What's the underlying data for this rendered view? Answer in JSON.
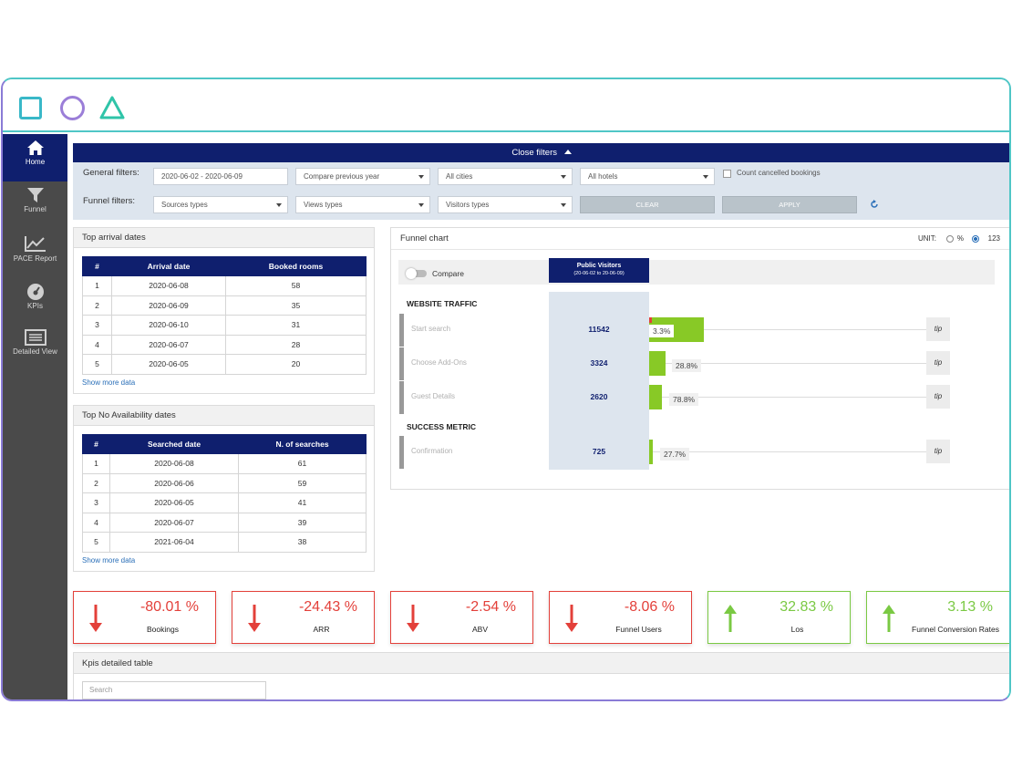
{
  "sidebar": {
    "items": [
      {
        "label": "Home",
        "icon": "home-icon"
      },
      {
        "label": "Funnel",
        "icon": "funnel-icon"
      },
      {
        "label": "PACE Report",
        "icon": "chart-line-icon"
      },
      {
        "label": "KPIs",
        "icon": "gauge-icon"
      },
      {
        "label": "Detailed View",
        "icon": "list-icon"
      }
    ]
  },
  "filters": {
    "toggle_label": "Close filters",
    "general_label": "General filters:",
    "funnel_label": "Funnel filters:",
    "date_range": "2020-06-02 - 2020-06-09",
    "compare": "Compare previous year",
    "cities": "All cities",
    "hotels": "All hotels",
    "count_cancelled": "Count cancelled bookings",
    "sources": "Sources types",
    "views": "Views types",
    "visitors": "Visitors types",
    "clear": "CLEAR",
    "apply": "APPLY"
  },
  "arrival": {
    "title": "Top arrival dates",
    "headers": [
      "#",
      "Arrival date",
      "Booked rooms"
    ],
    "rows": [
      [
        "1",
        "2020-06-08",
        "58"
      ],
      [
        "2",
        "2020-06-09",
        "35"
      ],
      [
        "3",
        "2020-06-10",
        "31"
      ],
      [
        "4",
        "2020-06-07",
        "28"
      ],
      [
        "5",
        "2020-06-05",
        "20"
      ]
    ],
    "more": "Show more data"
  },
  "noavail": {
    "title": "Top No Availability dates",
    "headers": [
      "#",
      "Searched date",
      "N. of searches"
    ],
    "rows": [
      [
        "1",
        "2020-06-08",
        "61"
      ],
      [
        "2",
        "2020-06-06",
        "59"
      ],
      [
        "3",
        "2020-06-05",
        "41"
      ],
      [
        "4",
        "2020-06-07",
        "39"
      ],
      [
        "5",
        "2021-06-04",
        "38"
      ]
    ],
    "more": "Show more data"
  },
  "funnel": {
    "title": "Funnel chart",
    "unit_label": "UNIT:",
    "unit_pct": "%",
    "unit_num": "123",
    "compare": "Compare",
    "column_title": "Public Visitors",
    "column_range": "(20-06-02 to 20-06-09)",
    "section_traffic": "WEBSITE TRAFFIC",
    "section_success": "SUCCESS METRIC",
    "stages": [
      {
        "label": "Start search",
        "value": "11542",
        "pct": "3.3%",
        "tip": "tip"
      },
      {
        "label": "Choose Add-Ons",
        "value": "3324",
        "pct": "28.8%",
        "tip": "tip"
      },
      {
        "label": "Guest Details",
        "value": "2620",
        "pct": "78.8%",
        "tip": "tip"
      },
      {
        "label": "Confirmation",
        "value": "725",
        "pct": "27.7%",
        "tip": "tip"
      }
    ]
  },
  "kpis": [
    {
      "value": "-80.01 %",
      "label": "Bookings",
      "trend": "down"
    },
    {
      "value": "-24.43 %",
      "label": "ARR",
      "trend": "down"
    },
    {
      "value": "-2.54 %",
      "label": "ABV",
      "trend": "down"
    },
    {
      "value": "-8.06 %",
      "label": "Funnel Users",
      "trend": "down"
    },
    {
      "value": "32.83 %",
      "label": "Los",
      "trend": "up"
    },
    {
      "value": "3.13 %",
      "label": "Funnel Conversion Rates",
      "trend": "up"
    }
  ],
  "kpi_table": {
    "title": "Kpis detailed table",
    "search_placeholder": "Search"
  },
  "colors": {
    "navy": "#0f1f6e",
    "down": "#e3403a",
    "up": "#7ac943",
    "bar": "#88c926"
  }
}
